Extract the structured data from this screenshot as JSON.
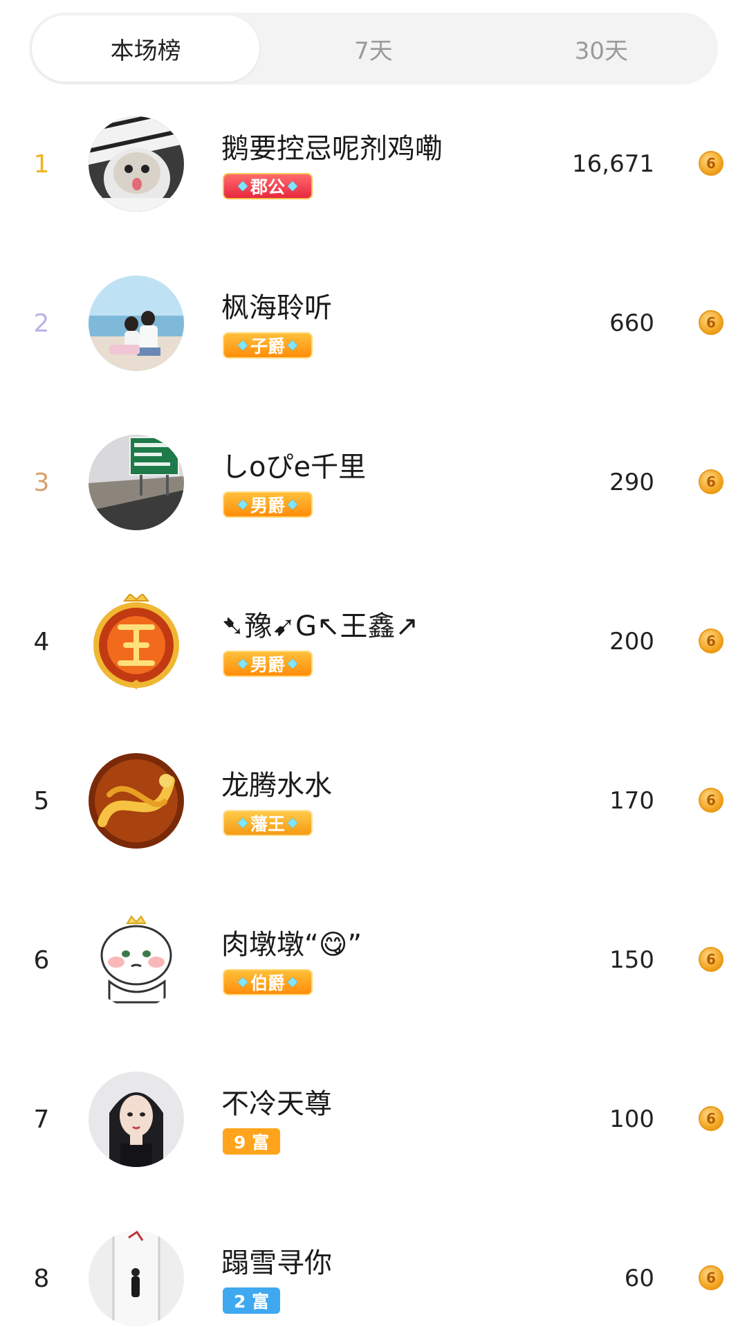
{
  "tabs": [
    {
      "label": "本场榜",
      "active": true
    },
    {
      "label": "7天",
      "active": false
    },
    {
      "label": "30天",
      "active": false
    }
  ],
  "rank_colors": {
    "1": "#f0b41e",
    "2": "#b9b3e6",
    "3": "#d6a06a"
  },
  "rows": [
    {
      "rank": "1",
      "name": "鹅要控忌呢剂鸡嘞",
      "badge": "郡公",
      "score": "16,671",
      "avatar": "cat-in-hood"
    },
    {
      "rank": "2",
      "name": "枫海聆听",
      "badge": "子爵",
      "score": "660",
      "avatar": "couple-at-beach"
    },
    {
      "rank": "3",
      "name": "しoぴe千里",
      "badge": "男爵",
      "score": "290",
      "avatar": "highway-sign"
    },
    {
      "rank": "4",
      "name": "➷豫➹G↖王鑫↗",
      "badge": "男爵",
      "score": "200",
      "avatar": "golden-king-emblem"
    },
    {
      "rank": "5",
      "name": "龙腾水水",
      "badge": "藩王",
      "score": "170",
      "avatar": "golden-dragon"
    },
    {
      "rank": "6",
      "name": "肉墩墩“😋”",
      "badge": "伯爵",
      "score": "150",
      "avatar": "cartoon-cat"
    },
    {
      "rank": "7",
      "name": "不冷天尊",
      "badge": "9 富",
      "score": "100",
      "avatar": "illustrated-girl"
    },
    {
      "rank": "8",
      "name": "蹋雪寻你",
      "badge": "2 富",
      "score": "60",
      "avatar": "figure-in-white"
    }
  ],
  "coin_glyph": "6"
}
